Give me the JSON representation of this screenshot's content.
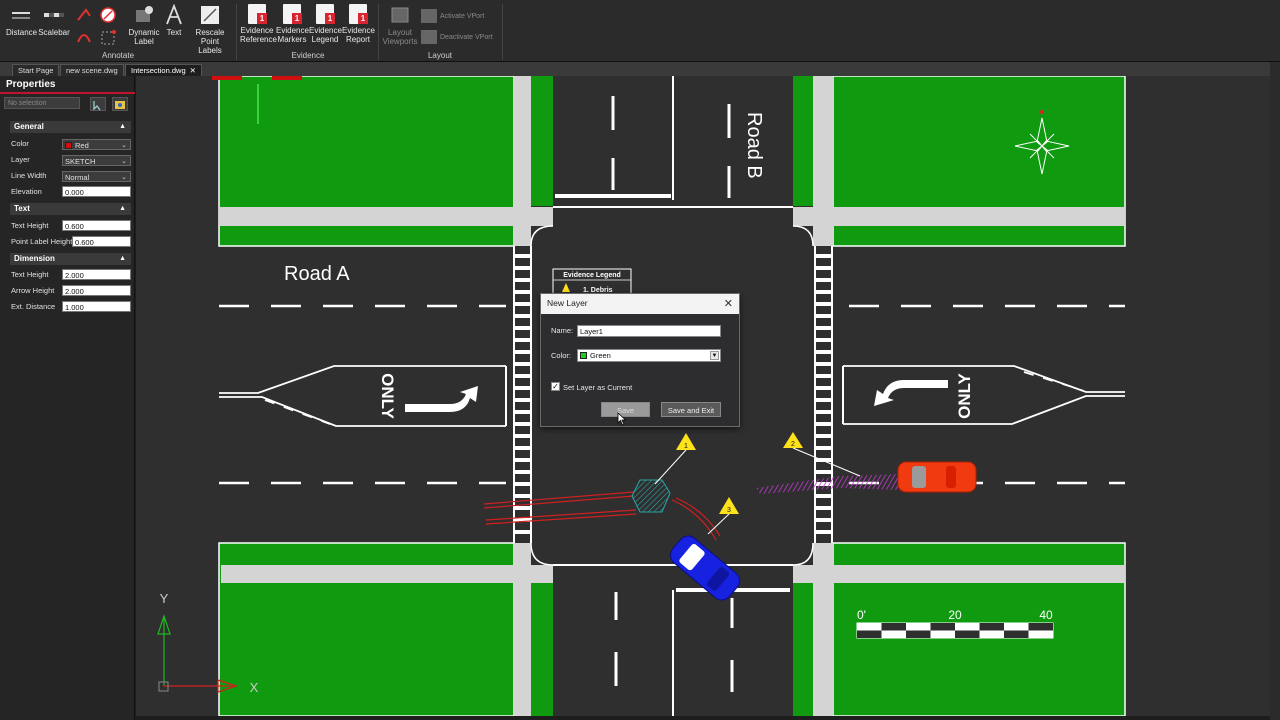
{
  "ribbon": {
    "annotate": {
      "group_label": "Annotate",
      "distance": "Distance",
      "scalebar": "Scalebar",
      "dynamic_label": [
        "Dynamic",
        "Label"
      ],
      "text": "Text",
      "rescale_point_labels": [
        "Rescale",
        "Point Labels"
      ]
    },
    "evidence": {
      "group_label": "Evidence",
      "badge": "1",
      "reference": [
        "Evidence",
        "Reference"
      ],
      "markers": [
        "Evidence",
        "Markers"
      ],
      "legend": [
        "Evidence",
        "Legend"
      ],
      "report": [
        "Evidence",
        "Report"
      ]
    },
    "layout": {
      "group_label": "Layout",
      "layout_viewports": [
        "Layout",
        "Viewports"
      ],
      "activate_vport": "Activate VPort",
      "deactivate_vport": "Deactivate VPort"
    }
  },
  "tabs": [
    {
      "label": "Start Page"
    },
    {
      "label": "new scene.dwg"
    },
    {
      "label": "Intersection.dwg",
      "close": "✕"
    }
  ],
  "properties": {
    "title": "Properties",
    "selection_placeholder": "No selection",
    "general": {
      "header": "General",
      "color_label": "Color",
      "color_value": "Red",
      "layer_label": "Layer",
      "layer_value": "SKETCH",
      "line_width_label": "Line Width",
      "line_width_value": "Normal",
      "elevation_label": "Elevation",
      "elevation_value": "0.000"
    },
    "text": {
      "header": "Text",
      "text_height_label": "Text Height",
      "text_height_value": "0.600",
      "point_label_height_label": "Point Label Height",
      "point_label_height_value": "0.600"
    },
    "dimension": {
      "header": "Dimension",
      "text_height_label": "Text Height",
      "text_height_value": "2.000",
      "arrow_height_label": "Arrow Height",
      "arrow_height_value": "2.000",
      "ext_distance_label": "Ext. Distance",
      "ext_distance_value": "1.000"
    }
  },
  "drawing": {
    "road_a": "Road A",
    "road_b": "Road B",
    "only_marking": "ONLY",
    "evidence_legend_title": "Evidence Legend",
    "evidence_legend_item": "1. Debris",
    "markers": [
      "1",
      "2",
      "3"
    ],
    "scale_labels": [
      "0'",
      "20",
      "40"
    ],
    "axis_y": "Y",
    "axis_x": "X"
  },
  "dialog": {
    "title": "New Layer",
    "close": "✕",
    "name_label": "Name:",
    "name_value": "Layer1",
    "color_label": "Color:",
    "color_value": "Green",
    "set_current_label": "Set Layer as Current",
    "check_mark": "✓",
    "save_label": "Save",
    "save_exit_label": "Save and Exit"
  },
  "colors": {
    "grass": "#0f9a0f",
    "asphalt": "#2f2f30",
    "sidewalk": "#d4d4d4",
    "blue_car": "#1722e0",
    "red_car": "#f23a10",
    "marker_yellow": "#ffe21a",
    "accent_red": "#c0142c"
  }
}
